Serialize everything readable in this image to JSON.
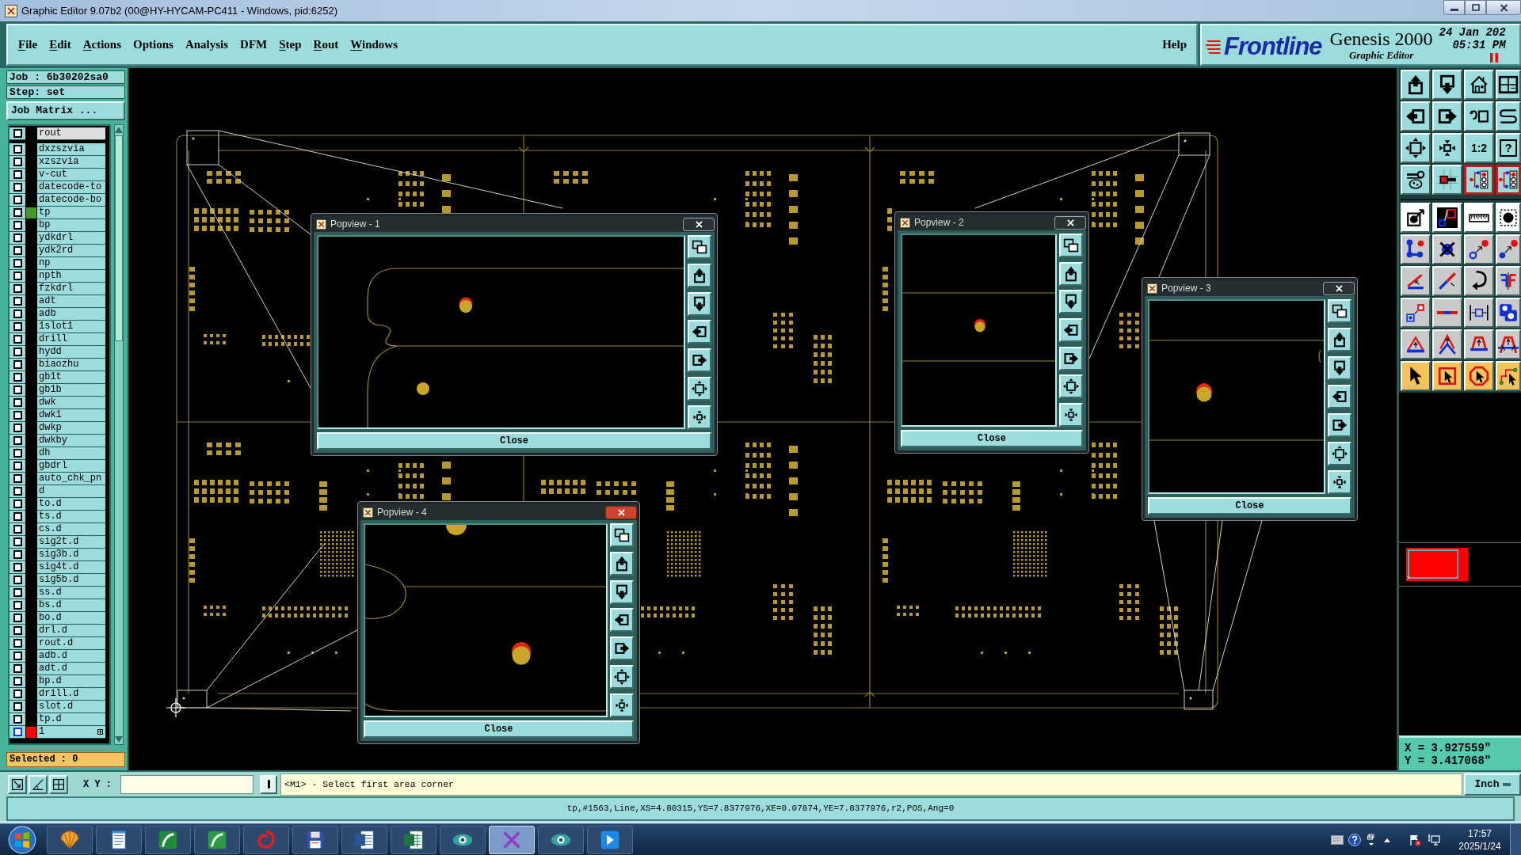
{
  "window": {
    "title": "Graphic Editor 9.07b2 (00@HY-HYCAM-PC411 - Windows, pid:6252)"
  },
  "menu": {
    "items": [
      {
        "label": "File",
        "mnemonic": true
      },
      {
        "label": "Edit",
        "mnemonic": true
      },
      {
        "label": "Actions",
        "mnemonic": true
      },
      {
        "label": "Options",
        "mnemonic": false
      },
      {
        "label": "Analysis",
        "mnemonic": false
      },
      {
        "label": "DFM",
        "mnemonic": false
      },
      {
        "label": "Step",
        "mnemonic": true
      },
      {
        "label": "Rout",
        "mnemonic": true
      },
      {
        "label": "Windows",
        "mnemonic": true
      }
    ],
    "help": {
      "label": "Help",
      "mnemonic": false
    }
  },
  "brand": {
    "logo": "Frontline",
    "product": "Genesis 2000",
    "module": "Graphic Editor",
    "date": "24 Jan 202",
    "time": "05:31 PM",
    "paused": true
  },
  "job_panel": {
    "job": "Job : 6b30202sa0",
    "step": "Step: set",
    "matrix_button": "Job Matrix ...",
    "pinned_layer": {
      "name": "rout",
      "checked": false,
      "selected": false
    },
    "layers": [
      {
        "name": "dxzszvia",
        "checked": false,
        "selected": false
      },
      {
        "name": "xzszvia",
        "checked": false,
        "selected": false
      },
      {
        "name": "v-cut",
        "checked": false,
        "selected": false
      },
      {
        "name": "datecode-to",
        "checked": false,
        "selected": false
      },
      {
        "name": "datecode-bo",
        "checked": false,
        "selected": false
      },
      {
        "name": "tp",
        "checked": false,
        "selected": false,
        "color": "#3e9b2c"
      },
      {
        "name": "bp",
        "checked": false,
        "selected": false
      },
      {
        "name": "ydkdrl",
        "checked": false,
        "selected": false
      },
      {
        "name": "ydk2rd",
        "checked": false,
        "selected": false
      },
      {
        "name": "np",
        "checked": false,
        "selected": false
      },
      {
        "name": "npth",
        "checked": false,
        "selected": false
      },
      {
        "name": "fzkdrl",
        "checked": false,
        "selected": false
      },
      {
        "name": "adt",
        "checked": false,
        "selected": false
      },
      {
        "name": "adb",
        "checked": false,
        "selected": false
      },
      {
        "name": "1slot1",
        "checked": false,
        "selected": false
      },
      {
        "name": "drill",
        "checked": false,
        "selected": false
      },
      {
        "name": "hydd",
        "checked": false,
        "selected": false
      },
      {
        "name": "biaozhu",
        "checked": false,
        "selected": false
      },
      {
        "name": "gb1t",
        "checked": false,
        "selected": false
      },
      {
        "name": "gb1b",
        "checked": false,
        "selected": false
      },
      {
        "name": "dwk",
        "checked": false,
        "selected": false
      },
      {
        "name": "dwk1",
        "checked": false,
        "selected": false
      },
      {
        "name": "dwkp",
        "checked": false,
        "selected": false
      },
      {
        "name": "dwkby",
        "checked": false,
        "selected": false
      },
      {
        "name": "dh",
        "checked": false,
        "selected": false
      },
      {
        "name": "gbdrl",
        "checked": false,
        "selected": false
      },
      {
        "name": "auto_chk_pn",
        "checked": false,
        "selected": false
      },
      {
        "name": "d",
        "checked": false,
        "selected": false
      },
      {
        "name": "to.d",
        "checked": false,
        "selected": false
      },
      {
        "name": "ts.d",
        "checked": false,
        "selected": false
      },
      {
        "name": "cs.d",
        "checked": false,
        "selected": false
      },
      {
        "name": "sig2t.d",
        "checked": false,
        "selected": false
      },
      {
        "name": "sig3b.d",
        "checked": false,
        "selected": false
      },
      {
        "name": "sig4t.d",
        "checked": false,
        "selected": false
      },
      {
        "name": "sig5b.d",
        "checked": false,
        "selected": false
      },
      {
        "name": "ss.d",
        "checked": false,
        "selected": false
      },
      {
        "name": "bs.d",
        "checked": false,
        "selected": false
      },
      {
        "name": "bo.d",
        "checked": false,
        "selected": false
      },
      {
        "name": "drl.d",
        "checked": false,
        "selected": false
      },
      {
        "name": "rout.d",
        "checked": false,
        "selected": false
      },
      {
        "name": "adb.d",
        "checked": false,
        "selected": false
      },
      {
        "name": "adt.d",
        "checked": false,
        "selected": false
      },
      {
        "name": "bp.d",
        "checked": false,
        "selected": false
      },
      {
        "name": "drill.d",
        "checked": false,
        "selected": false
      },
      {
        "name": "slot.d",
        "checked": false,
        "selected": false
      },
      {
        "name": "tp.d",
        "checked": false,
        "selected": false
      },
      {
        "name": "1",
        "checked": false,
        "selected": true,
        "color": "#ff0000"
      }
    ],
    "selected_count": "Selected : 0"
  },
  "popviews": [
    {
      "title": "Popview - 1",
      "active": false,
      "close": "Close"
    },
    {
      "title": "Popview - 2",
      "active": false,
      "close": "Close"
    },
    {
      "title": "Popview - 3",
      "active": false,
      "close": "Close"
    },
    {
      "title": "Popview - 4",
      "active": true,
      "close": "Close"
    }
  ],
  "toolbar": {
    "groups": [
      {
        "buttons": [
          {
            "pressed": false
          },
          {
            "pressed": false
          },
          {
            "pressed": false
          },
          {
            "pressed": false
          },
          {
            "pressed": false
          },
          {
            "pressed": false
          },
          {
            "pressed": false
          },
          {
            "pressed": false
          },
          {
            "pressed": false
          },
          {
            "pressed": false
          },
          {
            "label": "1:2",
            "pressed": false
          },
          {
            "label": "?",
            "pressed": false
          },
          {
            "pressed": false
          },
          {
            "pressed": false
          },
          {
            "pressed": true
          },
          {
            "pressed": true
          }
        ]
      },
      {
        "buttons": [
          {
            "pressed": false
          },
          {
            "pressed": false
          },
          {
            "pressed": false
          },
          {
            "pressed": false
          },
          {
            "pressed": false
          },
          {
            "pressed": false
          },
          {
            "pressed": false
          },
          {
            "pressed": false
          },
          {
            "pressed": false
          },
          {
            "pressed": false
          },
          {
            "pressed": false
          },
          {
            "pressed": false
          },
          {
            "pressed": false
          },
          {
            "pressed": false
          },
          {
            "pressed": false
          },
          {
            "pressed": false
          },
          {
            "pressed": false
          },
          {
            "pressed": false
          },
          {
            "pressed": false
          },
          {
            "pressed": false
          },
          {
            "pressed": false
          },
          {
            "pressed": false
          },
          {
            "pressed": false
          },
          {
            "pressed": false
          }
        ]
      }
    ]
  },
  "cursor_position": {
    "x": "X = 3.927559\"",
    "y": "Y = 3.417068\""
  },
  "command_line": {
    "label": "X Y :",
    "prompt": "<M1> - Select first area corner",
    "units": "Inch"
  },
  "status_bar": {
    "text": "tp,#1563,Line,XS=4.80315,YS=7.8377976,XE=0.07874,YE=7.8377976,r2,POS,Ang=0"
  },
  "taskbar": {
    "apps": [
      {
        "active": false
      },
      {
        "active": false
      },
      {
        "active": false
      },
      {
        "active": false
      },
      {
        "active": false
      },
      {
        "active": false
      },
      {
        "active": false
      },
      {
        "active": false
      },
      {
        "active": false
      },
      {
        "active": true
      },
      {
        "active": false
      },
      {
        "active": false
      }
    ],
    "time": "17:57",
    "date": "2025/1/24"
  }
}
